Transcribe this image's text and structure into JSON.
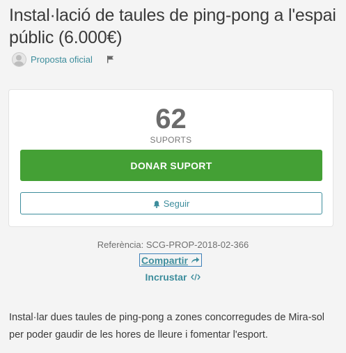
{
  "proposal": {
    "title": "Instal·lació de taules de ping-pong a l'espai públic (6.000€)",
    "author_label": "Proposta oficial",
    "supports_count": "62",
    "supports_label": "SUPORTS",
    "support_button": "DONAR SUPORT",
    "follow_button": "Seguir",
    "reference": "Referència: SCG-PROP-2018-02-366",
    "share_label": "Compartir",
    "embed_label": "Incrustar",
    "description": "Instal·lar dues taules de ping-pong a zones concorregudes de Mira-sol per poder gaudir de les hores de lleure i fomentar l'esport."
  },
  "colors": {
    "accent": "#3d8d9c",
    "support_green": "#44a035"
  },
  "icons": {
    "flag": "flag-icon",
    "bell": "bell-icon",
    "share": "share-arrow-icon",
    "embed": "code-icon",
    "avatar": "user-avatar-icon"
  }
}
